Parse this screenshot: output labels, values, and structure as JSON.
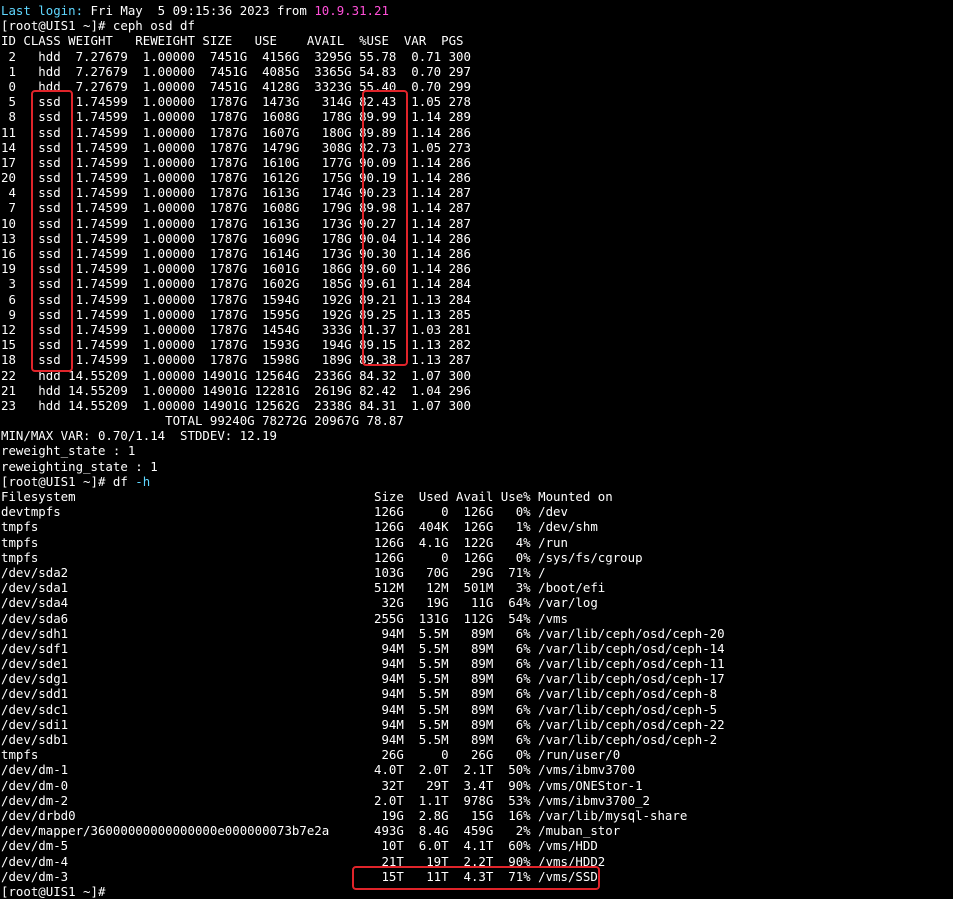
{
  "terminal": {
    "login": {
      "label": "Last login:",
      "when": " Fri May  5 09:15:36 2023 from ",
      "ip": "10.9.31.21"
    },
    "prompt1": "[root@UIS1 ~]# ceph osd df",
    "osd_header": "ID CLASS WEIGHT   REWEIGHT SIZE   USE    AVAIL  %USE  VAR  PGS",
    "osd_rows": [
      " 2   hdd  7.27679  1.00000  7451G  4156G  3295G 55.78  0.71 300",
      " 1   hdd  7.27679  1.00000  7451G  4085G  3365G 54.83  0.70 297",
      " 0   hdd  7.27679  1.00000  7451G  4128G  3323G 55.40  0.70 299",
      " 5   ssd  1.74599  1.00000  1787G  1473G   314G 82.43  1.05 278",
      " 8   ssd  1.74599  1.00000  1787G  1608G   178G 89.99  1.14 289",
      "11   ssd  1.74599  1.00000  1787G  1607G   180G 89.89  1.14 286",
      "14   ssd  1.74599  1.00000  1787G  1479G   308G 82.73  1.05 273",
      "17   ssd  1.74599  1.00000  1787G  1610G   177G 90.09  1.14 286",
      "20   ssd  1.74599  1.00000  1787G  1612G   175G 90.19  1.14 286",
      " 4   ssd  1.74599  1.00000  1787G  1613G   174G 90.23  1.14 287",
      " 7   ssd  1.74599  1.00000  1787G  1608G   179G 89.98  1.14 287",
      "10   ssd  1.74599  1.00000  1787G  1613G   173G 90.27  1.14 287",
      "13   ssd  1.74599  1.00000  1787G  1609G   178G 90.04  1.14 286",
      "16   ssd  1.74599  1.00000  1787G  1614G   173G 90.30  1.14 286",
      "19   ssd  1.74599  1.00000  1787G  1601G   186G 89.60  1.14 286",
      " 3   ssd  1.74599  1.00000  1787G  1602G   185G 89.61  1.14 284",
      " 6   ssd  1.74599  1.00000  1787G  1594G   192G 89.21  1.13 284",
      " 9   ssd  1.74599  1.00000  1787G  1595G   192G 89.25  1.13 285",
      "12   ssd  1.74599  1.00000  1787G  1454G   333G 81.37  1.03 281",
      "15   ssd  1.74599  1.00000  1787G  1593G   194G 89.15  1.13 282",
      "18   ssd  1.74599  1.00000  1787G  1598G   189G 89.38  1.13 287",
      "22   hdd 14.55209  1.00000 14901G 12564G  2336G 84.32  1.07 300",
      "21   hdd 14.55209  1.00000 14901G 12281G  2619G 82.42  1.04 296",
      "23   hdd 14.55209  1.00000 14901G 12562G  2338G 84.31  1.07 300"
    ],
    "osd_total": "                      TOTAL 99240G 78272G 20967G 78.87",
    "minmax": "MIN/MAX VAR: 0.70/1.14  STDDEV: 12.19",
    "reweight_state": "reweight_state : 1",
    "reweighting_state": "reweighting_state : 1",
    "prompt2_cmd": "[root@UIS1 ~]# df ",
    "prompt2_flag": "-h",
    "df_header": "Filesystem                                        Size  Used Avail Use% Mounted on",
    "df_rows": [
      "devtmpfs                                          126G     0  126G   0% /dev",
      "tmpfs                                             126G  404K  126G   1% /dev/shm",
      "tmpfs                                             126G  4.1G  122G   4% /run",
      "tmpfs                                             126G     0  126G   0% /sys/fs/cgroup",
      "/dev/sda2                                         103G   70G   29G  71% /",
      "/dev/sda1                                         512M   12M  501M   3% /boot/efi",
      "/dev/sda4                                          32G   19G   11G  64% /var/log",
      "/dev/sda6                                         255G  131G  112G  54% /vms",
      "/dev/sdh1                                          94M  5.5M   89M   6% /var/lib/ceph/osd/ceph-20",
      "/dev/sdf1                                          94M  5.5M   89M   6% /var/lib/ceph/osd/ceph-14",
      "/dev/sde1                                          94M  5.5M   89M   6% /var/lib/ceph/osd/ceph-11",
      "/dev/sdg1                                          94M  5.5M   89M   6% /var/lib/ceph/osd/ceph-17",
      "/dev/sdd1                                          94M  5.5M   89M   6% /var/lib/ceph/osd/ceph-8",
      "/dev/sdc1                                          94M  5.5M   89M   6% /var/lib/ceph/osd/ceph-5",
      "/dev/sdi1                                          94M  5.5M   89M   6% /var/lib/ceph/osd/ceph-22",
      "/dev/sdb1                                          94M  5.5M   89M   6% /var/lib/ceph/osd/ceph-2",
      "tmpfs                                              26G     0   26G   0% /run/user/0",
      "/dev/dm-1                                         4.0T  2.0T  2.1T  50% /vms/ibmv3700",
      "/dev/dm-0                                          32T   29T  3.4T  90% /vms/ONEStor-1",
      "/dev/dm-2                                         2.0T  1.1T  978G  53% /vms/ibmv3700_2",
      "/dev/drbd0                                         19G  2.8G   15G  16% /var/lib/mysql-share",
      "/dev/mapper/36000000000000000e000000073b7e2a      493G  8.4G  459G   2% /muban_stor",
      "/dev/dm-5                                          10T  6.0T  4.1T  60% /vms/HDD",
      "/dev/dm-4                                          21T   19T  2.2T  90% /vms/HDD2",
      "/dev/dm-3                                          15T   11T  4.3T  71% /vms/SSD"
    ],
    "partial_last": "[root@UIS1 ~]# "
  }
}
